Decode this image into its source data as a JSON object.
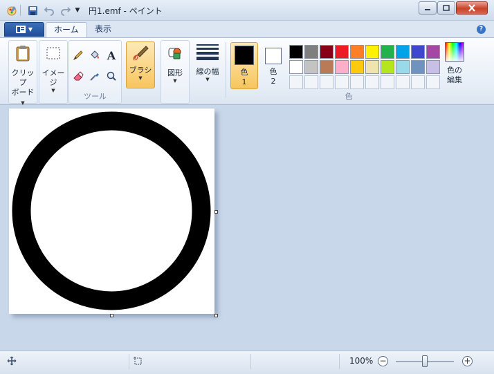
{
  "window": {
    "title": "円1.emf - ペイント"
  },
  "tabs": [
    "ホーム",
    "表示"
  ],
  "ribbon": {
    "clipboard": {
      "line1": "クリップ",
      "line2": "ボード"
    },
    "image": {
      "label": "イメージ"
    },
    "tools": {
      "label": "ツール"
    },
    "brush": {
      "label": "ブラシ"
    },
    "shapes": {
      "label": "図形"
    },
    "line_width": {
      "label": "線の幅"
    },
    "color1": {
      "line1": "色",
      "line2": "1",
      "value": "#000000"
    },
    "color2": {
      "line1": "色",
      "line2": "2",
      "value": "#ffffff"
    },
    "colors_group": {
      "label": "色"
    },
    "edit_colors": {
      "line1": "色の",
      "line2": "編集"
    },
    "palette": [
      "#000000",
      "#7f7f7f",
      "#880015",
      "#ed1c24",
      "#ff7f27",
      "#fff200",
      "#22b14c",
      "#00a2e8",
      "#3f48cc",
      "#a349a4",
      "#ffffff",
      "#c3c3c3",
      "#b97a57",
      "#ffaec9",
      "#ffc90e",
      "#efe4b0",
      "#b5e61d",
      "#99d9ea",
      "#7092be",
      "#c8bfe7"
    ]
  },
  "status": {
    "zoom": "100%",
    "zoom_level": 0.5
  },
  "colors": {
    "accent": "#1e4f9c",
    "active_tool": "#f8c55e",
    "workspace": "#c9d7ea"
  }
}
